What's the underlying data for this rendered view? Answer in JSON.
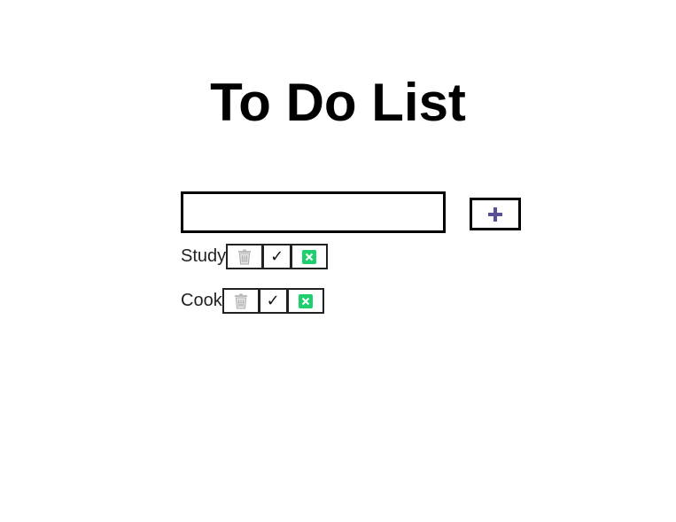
{
  "title": "To Do List",
  "input": {
    "value": "",
    "placeholder": ""
  },
  "add_button": {
    "icon": "plus-icon",
    "color": "#5b4f96"
  },
  "todos": [
    {
      "text": "Study",
      "actions": [
        "trash-icon",
        "checkmark-icon",
        "cross-box-icon"
      ]
    },
    {
      "text": "Cook",
      "actions": [
        "trash-icon",
        "checkmark-icon",
        "cross-box-icon"
      ]
    }
  ],
  "icons": {
    "check_glyph": "✓"
  },
  "colors": {
    "cancel_icon_bg": "#1fcf6e",
    "border": "#000000"
  }
}
